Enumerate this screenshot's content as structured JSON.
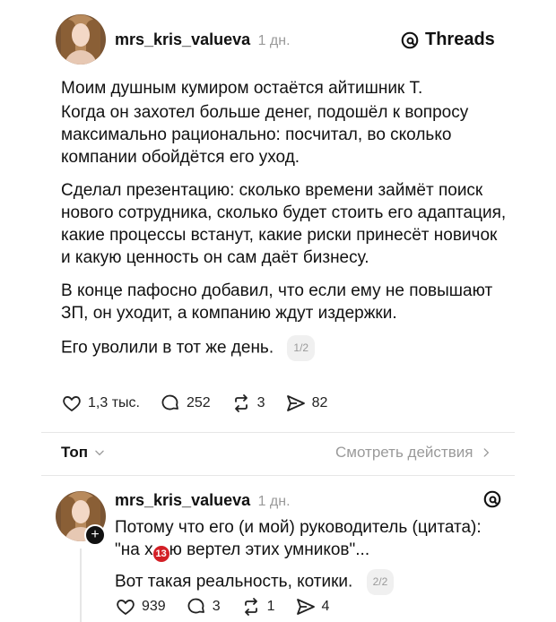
{
  "post": {
    "author": {
      "username": "mrs_kris_valueva",
      "time": "1 дн.",
      "avatar_icon": "avatar-photo"
    },
    "brand": "Threads",
    "paragraphs": [
      "Моим душным кумиром остаётся айтишник Т.",
      "Когда он захотел больше денег, подошёл к вопросу максимально рационально: посчитал, во сколько компании обойдётся его уход.",
      "Сделал презентацию: сколько времени займёт поиск нового сотрудника, сколько будет стоить его адаптация, какие процессы встанут, какие риски принесёт новичок и какую ценность он сам даёт бизнесу.",
      "В конце пафосно добавил, что если ему не повышают ЗП, он уходит, а компанию ждут издержки.",
      "Его уволили в тот же день."
    ],
    "page_tag": "1/2",
    "stats": {
      "likes": "1,3 тыс.",
      "comments": "252",
      "reposts": "3",
      "shares": "82"
    }
  },
  "toolbar": {
    "sort_label": "Топ",
    "see_activity": "Смотреть действия"
  },
  "reply": {
    "author": {
      "username": "mrs_kris_valueva",
      "time": "1 дн."
    },
    "line1": "Потому что его (и мой) руководитель (цитата):",
    "line2_pre": "\"на х",
    "emoji_label": "13",
    "line2_post": "ю вертел этих умников\"...",
    "line3": "Вот такая реальность, котики.",
    "page_tag": "2/2",
    "stats": {
      "likes": "939",
      "comments": "3",
      "reposts": "1",
      "shares": "4"
    }
  },
  "colors": {
    "text": "#111111",
    "muted": "#9a9a9a",
    "divider": "#e6e6e6",
    "badge_red": "#d31f26"
  }
}
